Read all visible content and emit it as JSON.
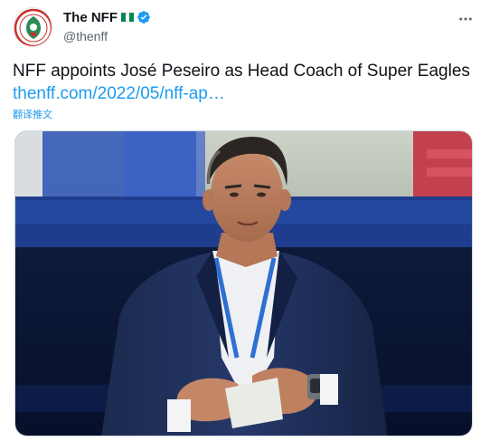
{
  "account": {
    "display_name": "The NFF",
    "handle": "@thenff",
    "avatar_icon": "nff-crest-icon",
    "flag_colors": [
      "#008751",
      "#ffffff",
      "#008751"
    ],
    "verified_color": "#1d9bf0"
  },
  "tweet": {
    "text": "NFF appoints José Peseiro as Head Coach of Super Eagles ",
    "link": "thenff.com/2022/05/nff-ap…",
    "translate_label": "翻译推文"
  },
  "media": {
    "kind": "photo",
    "subject": "man-in-navy-suit-photo"
  },
  "colors": {
    "link": "#1d9bf0",
    "text": "#0f1419",
    "secondary": "#536471"
  }
}
